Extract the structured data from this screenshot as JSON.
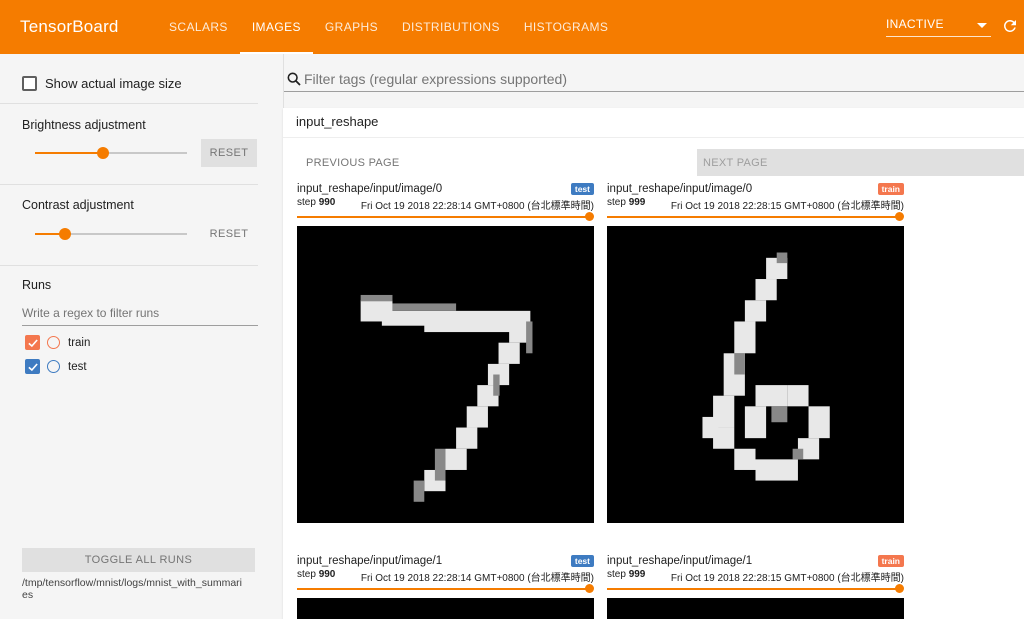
{
  "app": {
    "brand": "TensorBoard",
    "tabs": [
      {
        "label": "SCALARS"
      },
      {
        "label": "IMAGES"
      },
      {
        "label": "GRAPHS"
      },
      {
        "label": "DISTRIBUTIONS"
      },
      {
        "label": "HISTOGRAMS"
      }
    ],
    "active_tab": "IMAGES",
    "plugin_select": "INACTIVE",
    "accent_color": "#f57c00"
  },
  "sidebar": {
    "show_actual_size_label": "Show actual image size",
    "show_actual_size_checked": false,
    "brightness_label": "Brightness adjustment",
    "brightness_value": 0.45,
    "contrast_label": "Contrast adjustment",
    "contrast_value": 0.2,
    "reset_label": "RESET",
    "runs_label": "Runs",
    "runs_filter_placeholder": "Write a regex to filter runs",
    "runs": [
      {
        "name": "train",
        "checked": true,
        "color": "#f4774e"
      },
      {
        "name": "test",
        "checked": true,
        "color": "#3e7bc1"
      }
    ],
    "toggle_all_label": "TOGGLE ALL RUNS",
    "logdir": "/tmp/tensorflow/mnist/logs/mnist_with_summaries"
  },
  "main": {
    "filter_placeholder": "Filter tags (regular expressions supported)",
    "category_title": "input_reshape",
    "prev_page": "PREVIOUS PAGE",
    "next_page": "NEXT PAGE",
    "panels": [
      {
        "tag": "input_reshape/input/image/0",
        "run": "test",
        "step_label": "step",
        "step": "990",
        "time": "Fri Oct 19 2018 22:28:14 GMT+0800 (台北標準時間)",
        "digit": "7"
      },
      {
        "tag": "input_reshape/input/image/0",
        "run": "train",
        "step_label": "step",
        "step": "999",
        "time": "Fri Oct 19 2018 22:28:15 GMT+0800 (台北標準時間)",
        "digit": "6"
      },
      {
        "tag": "input_reshape/input/image/1",
        "run": "test",
        "step_label": "step",
        "step": "990",
        "time": "Fri Oct 19 2018 22:28:14 GMT+0800 (台北標準時間)",
        "digit": ""
      },
      {
        "tag": "input_reshape/input/image/1",
        "run": "train",
        "step_label": "step",
        "step": "999",
        "time": "Fri Oct 19 2018 22:28:15 GMT+0800 (台北標準時間)",
        "digit": ""
      }
    ]
  }
}
